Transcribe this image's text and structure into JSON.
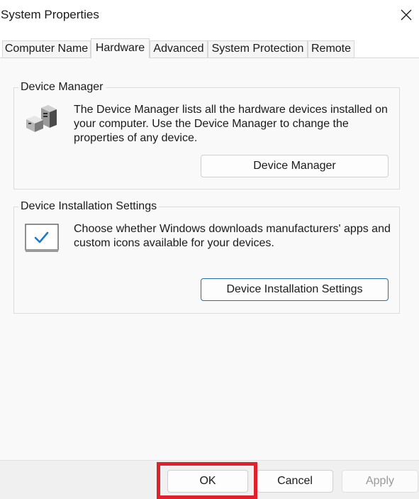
{
  "window": {
    "title": "System Properties"
  },
  "tabs": [
    {
      "label": "Computer Name",
      "active": false
    },
    {
      "label": "Hardware",
      "active": true
    },
    {
      "label": "Advanced",
      "active": false
    },
    {
      "label": "System Protection",
      "active": false
    },
    {
      "label": "Remote",
      "active": false
    }
  ],
  "device_manager": {
    "legend": "Device Manager",
    "description": "The Device Manager lists all the hardware devices installed on your computer. Use the Device Manager to change the properties of any device.",
    "button_label": "Device Manager",
    "icon": "device-manager-icon"
  },
  "device_installation": {
    "legend": "Device Installation Settings",
    "description": "Choose whether Windows downloads manufacturers' apps and custom icons available for your devices.",
    "button_label": "Device Installation Settings",
    "icon": "checkbox-monitor-icon"
  },
  "footer": {
    "ok_label": "OK",
    "cancel_label": "Cancel",
    "apply_label": "Apply"
  },
  "colors": {
    "highlight": "#e0202a",
    "focus_border": "#1f6fb5",
    "check_blue": "#1f7ac8"
  }
}
